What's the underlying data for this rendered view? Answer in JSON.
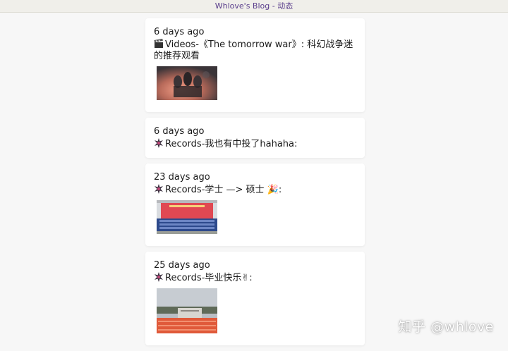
{
  "window": {
    "title": "Whlove's Blog - 动态"
  },
  "feed": [
    {
      "time": "6 days ago",
      "icon": "clapperboard-icon",
      "text": "Videos-《The tomorrow war》: 科幻战争迷的推荐观看",
      "has_image": true
    },
    {
      "time": "6 days ago",
      "icon": "sparkle-icon",
      "text": "Records-我也有中投了hahaha:",
      "has_image": false
    },
    {
      "time": "23 days ago",
      "icon": "sparkle-icon",
      "text": "Records-学士 —> 硕士 🎉:",
      "has_image": true
    },
    {
      "time": "25 days ago",
      "icon": "sparkle-icon",
      "text": "Records-毕业快乐✌:",
      "has_image": true
    }
  ],
  "watermark": "知乎 @whlove"
}
